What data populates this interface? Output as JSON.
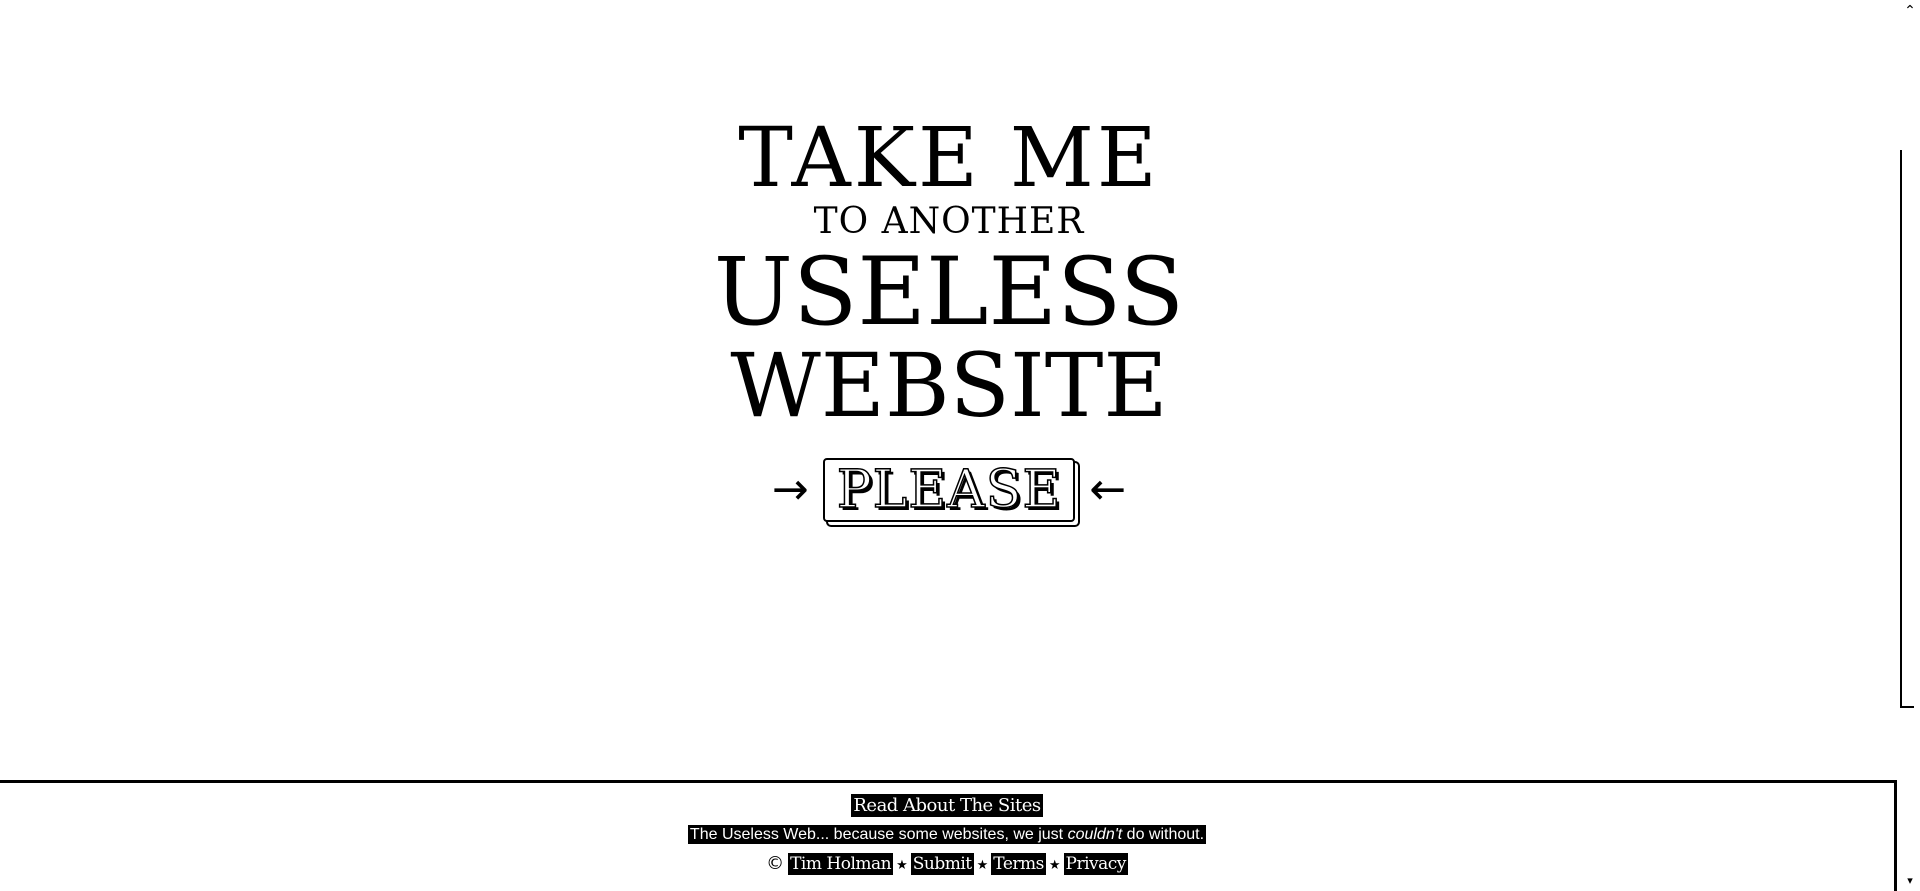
{
  "headline": {
    "line1": "TAKE ME",
    "line2": "TO ANOTHER",
    "line3": "USELESS",
    "line4": "WEBSITE"
  },
  "please_button": {
    "label": "PLEASE",
    "left_arrow": "→",
    "right_arrow": "←"
  },
  "footer": {
    "read_about": "Read About The Sites",
    "tagline_before": "The Useless Web... because some websites, we just ",
    "tagline_emphasis": "couldn't",
    "tagline_after": " do without.",
    "copyright_symbol": "©",
    "author": "Tim Holman",
    "separator": "★",
    "links": {
      "submit": "Submit",
      "terms": "Terms",
      "privacy": "Privacy"
    }
  },
  "scrollbar": {
    "up_icon": "⌃",
    "down_icon": "▾"
  }
}
